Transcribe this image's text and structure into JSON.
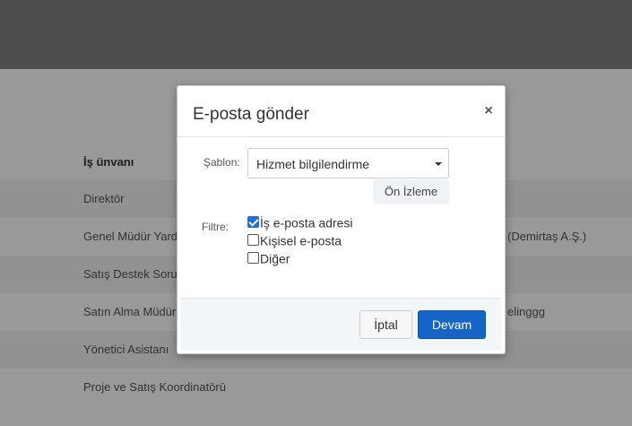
{
  "background": {
    "table_header": "İş ünvanı",
    "rows": [
      {
        "title": "Direktör",
        "extra": "",
        "striped": true
      },
      {
        "title": "Genel Müdür Yardımcısı",
        "extra": "(Demirtaş A.Ş.)",
        "striped": false
      },
      {
        "title": "Satış Destek Sorumlusu",
        "extra": "",
        "striped": true
      },
      {
        "title": "Satın Alma Müdürü",
        "extra": "elinggg",
        "striped": false
      },
      {
        "title": "Yönetici Asistanı",
        "extra": "",
        "striped": true
      },
      {
        "title": "Proje ve Satış Koordinatörü",
        "extra": "",
        "striped": false
      }
    ]
  },
  "modal": {
    "title": "E-posta gönder",
    "close_icon": "×",
    "template_label": "Şablon:",
    "template_value": "Hizmet bilgilendirme",
    "preview_label": "Ön İzleme",
    "filter_label": "Filtre:",
    "filters": [
      {
        "label": "İş e-posta adresi",
        "checked": true
      },
      {
        "label": "Kişisel e-posta",
        "checked": false
      },
      {
        "label": "Diğer",
        "checked": false
      }
    ],
    "cancel_label": "İptal",
    "continue_label": "Devam"
  },
  "colors": {
    "primary": "#1565c9",
    "overlay": "rgba(0,0,0,0.40)"
  }
}
